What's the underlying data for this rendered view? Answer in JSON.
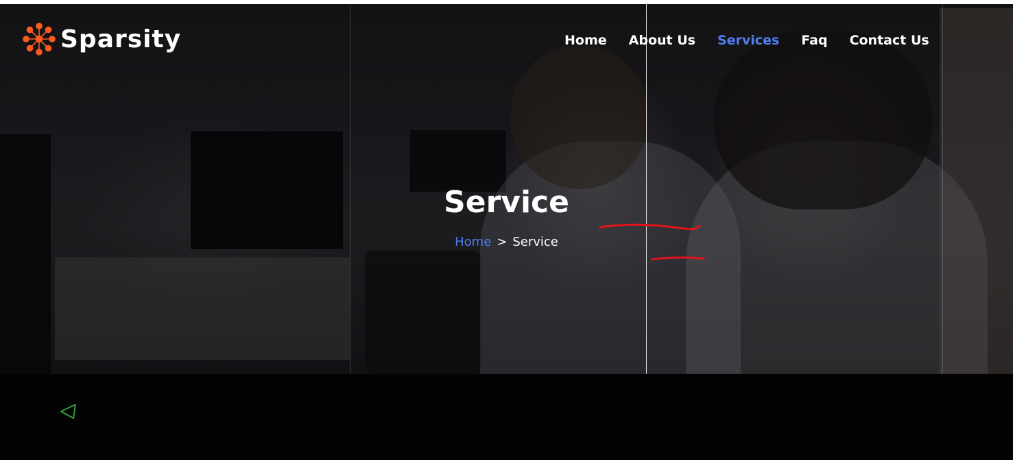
{
  "brand": {
    "name": "Sparsity",
    "accent": "#ff5a1f"
  },
  "nav": {
    "items": [
      {
        "label": "Home",
        "active": false
      },
      {
        "label": "About Us",
        "active": false
      },
      {
        "label": "Services",
        "active": true
      },
      {
        "label": "Faq",
        "active": false
      },
      {
        "label": "Contact Us",
        "active": false
      }
    ],
    "active_color": "#4f7cf0"
  },
  "hero": {
    "title": "Service",
    "breadcrumb": {
      "home": "Home",
      "separator": ">",
      "current": "Service"
    }
  },
  "annotations": {
    "underline_color": "#e0141a"
  },
  "footer": {
    "icon": "triangle-play-icon",
    "icon_color": "#2ea043"
  }
}
